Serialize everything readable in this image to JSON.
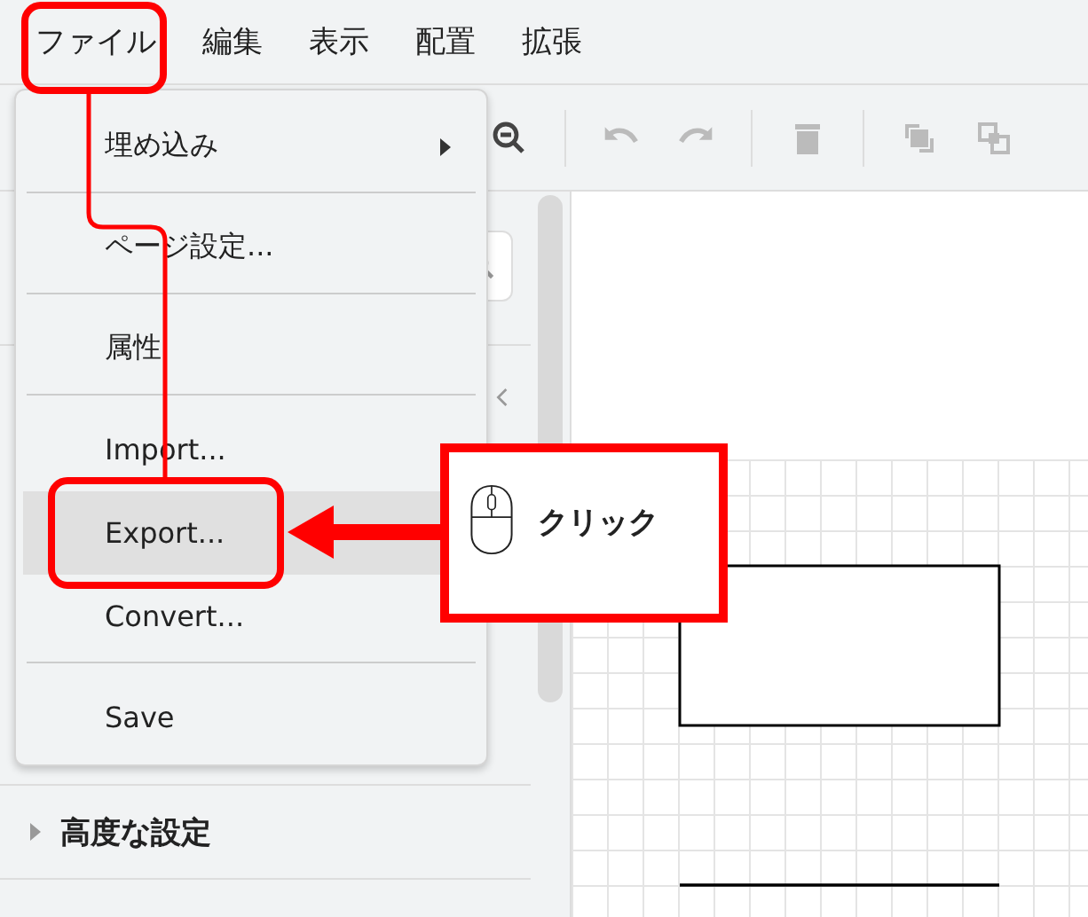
{
  "menubar": [
    "ファイル",
    "編集",
    "表示",
    "配置",
    "拡張"
  ],
  "file_menu": [
    {
      "kind": "submenu",
      "label": "埋め込み",
      "highlighted": false
    },
    {
      "kind": "separator"
    },
    {
      "kind": "item",
      "label": "ページ設定...",
      "highlighted": false
    },
    {
      "kind": "separator"
    },
    {
      "kind": "item",
      "label": "属性",
      "highlighted": false
    },
    {
      "kind": "separator"
    },
    {
      "kind": "item",
      "label": "Import...",
      "highlighted": false
    },
    {
      "kind": "item",
      "label": "Export...",
      "highlighted": true
    },
    {
      "kind": "item",
      "label": "Convert...",
      "highlighted": false
    },
    {
      "kind": "separator"
    },
    {
      "kind": "item",
      "label": "Save",
      "highlighted": false
    }
  ],
  "sidebar": {
    "sections": [
      {
        "label": "高度な設定",
        "expanded": false
      }
    ]
  },
  "callout": {
    "label": "クリック"
  }
}
